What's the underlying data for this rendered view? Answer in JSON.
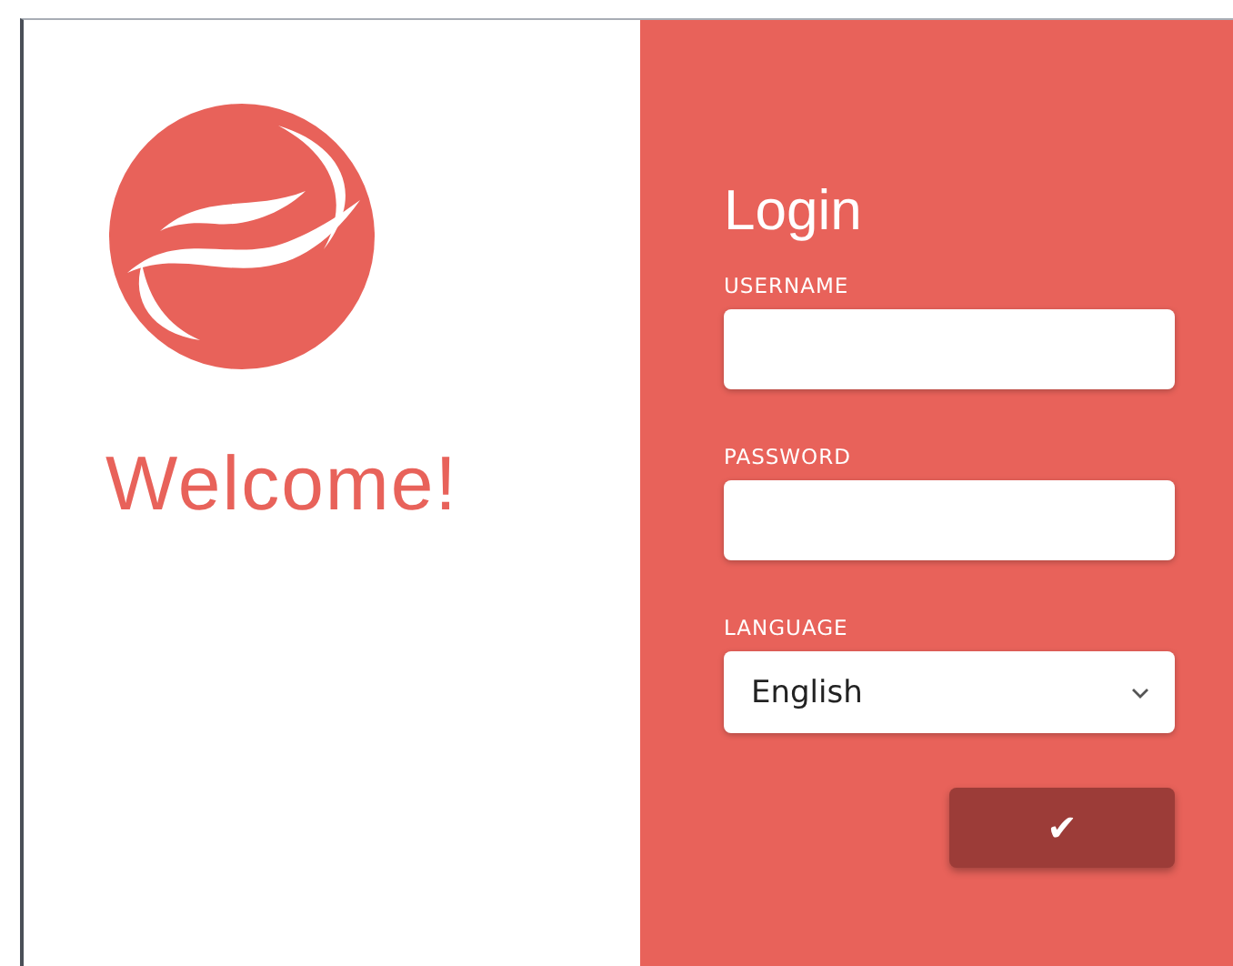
{
  "welcome": "Welcome!",
  "login": {
    "title": "Login",
    "fields": [
      {
        "kind": "text",
        "label": "USERNAME"
      },
      {
        "kind": "password",
        "label": "PASSWORD"
      },
      {
        "kind": "select",
        "label": "LANGUAGE",
        "value": "English"
      }
    ],
    "submit": "✔"
  }
}
